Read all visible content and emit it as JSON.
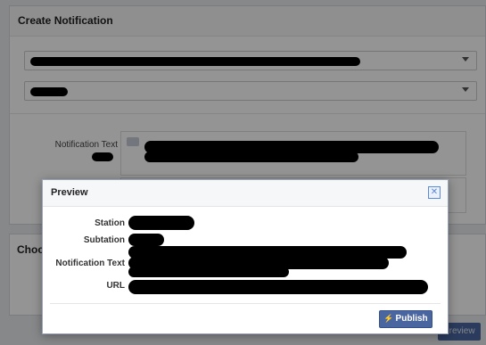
{
  "create_panel": {
    "title": "Create Notification",
    "notification_text_label": "Notification Text"
  },
  "choose_panel": {
    "title": "Choo"
  },
  "background": {
    "preview_label": "Preview"
  },
  "modal": {
    "title": "Preview",
    "close_icon": "close-icon",
    "labels": {
      "station": "Station",
      "subtation": "Subtation",
      "notification_text": "Notification Text",
      "url": "URL"
    },
    "publish_label": "Publish",
    "publish_icon": "lightning-icon"
  },
  "colors": {
    "primary_button": "#4a66a0",
    "redaction": "#000000"
  }
}
